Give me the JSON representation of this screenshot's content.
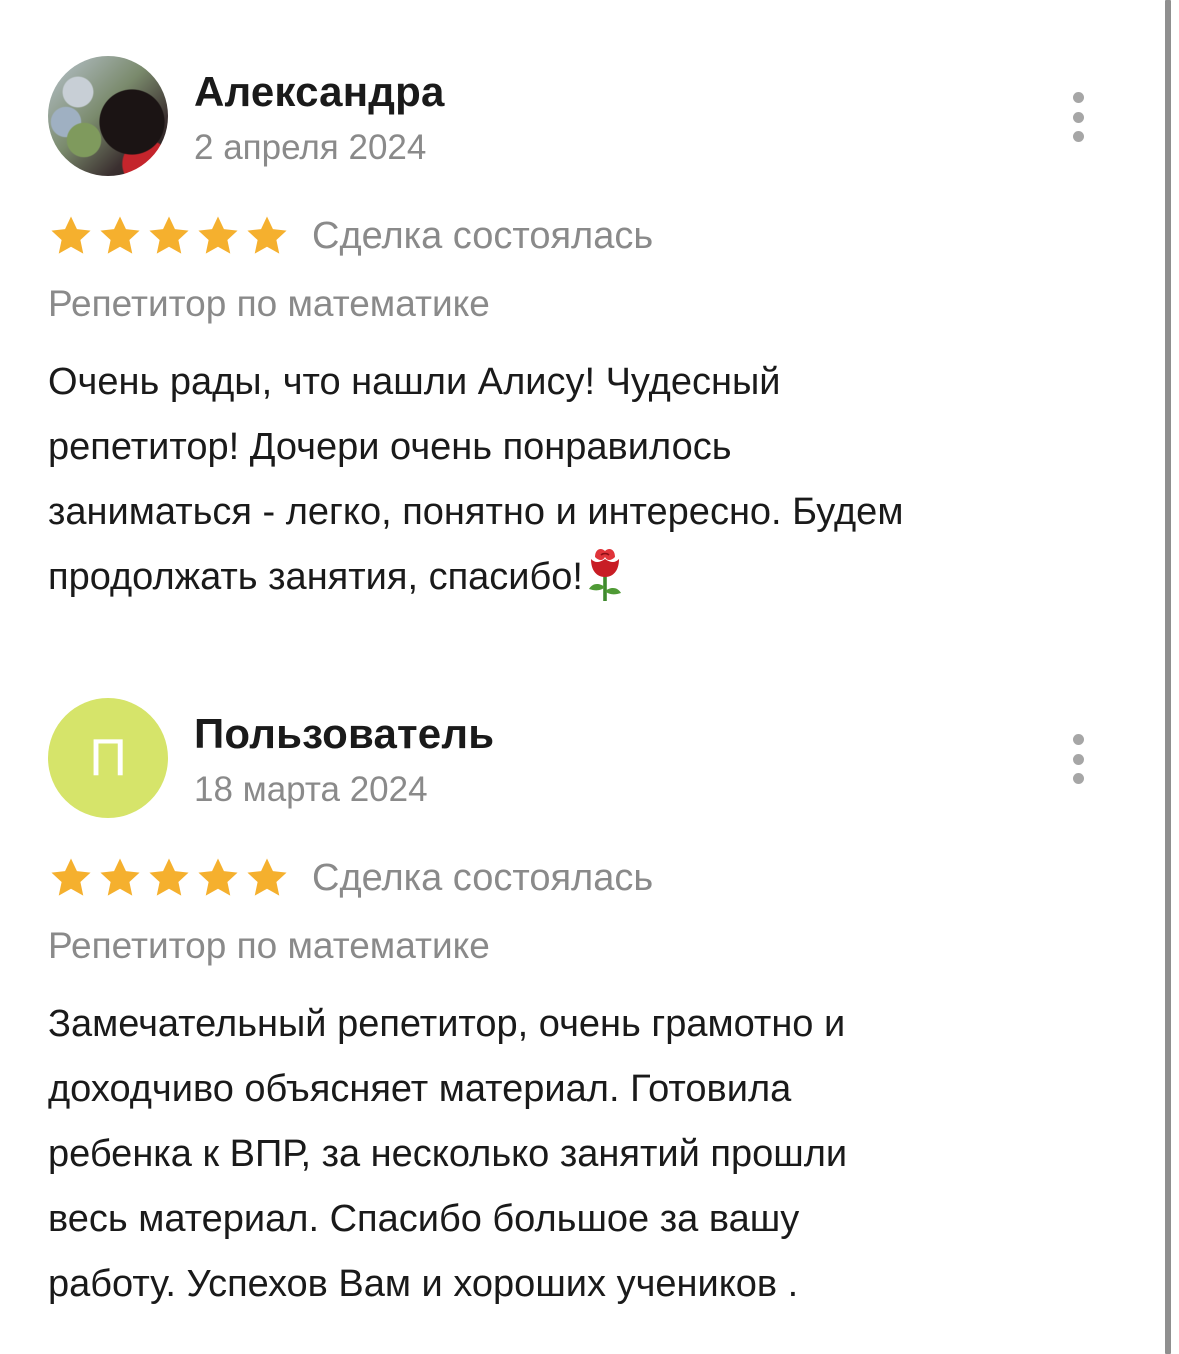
{
  "reviews": [
    {
      "author": "Александра",
      "date": "2 апреля 2024",
      "avatar": {
        "type": "photo"
      },
      "rating": 5,
      "status": "Сделка состоялась",
      "category": "Репетитор по математике",
      "text": "Очень рады, что нашли Алису! Чудесный\nрепетитор! Дочери очень понравилось\nзаниматься - легко, понятно и интересно. Будем\nпродолжать занятия, спасибо!",
      "emoji": "rose-icon"
    },
    {
      "author": "Пользователь",
      "date": "18 марта 2024",
      "avatar": {
        "type": "letter",
        "letter": "П",
        "color": "#d6e46a"
      },
      "rating": 5,
      "status": "Сделка состоялась",
      "category": "Репетитор по математике",
      "text": "Замечательный репетитор, очень грамотно и\nдоходчиво объясняет материал. Готовила\nребенка к ВПР, за несколько занятий прошли\nвесь материал. Спасибо большое за вашу\nработу. Успехов Вам и хороших учеников ."
    }
  ],
  "colors": {
    "star": "#f5b02e",
    "secondary_text": "#8a8a8a",
    "primary_text": "#1a1a1a"
  }
}
